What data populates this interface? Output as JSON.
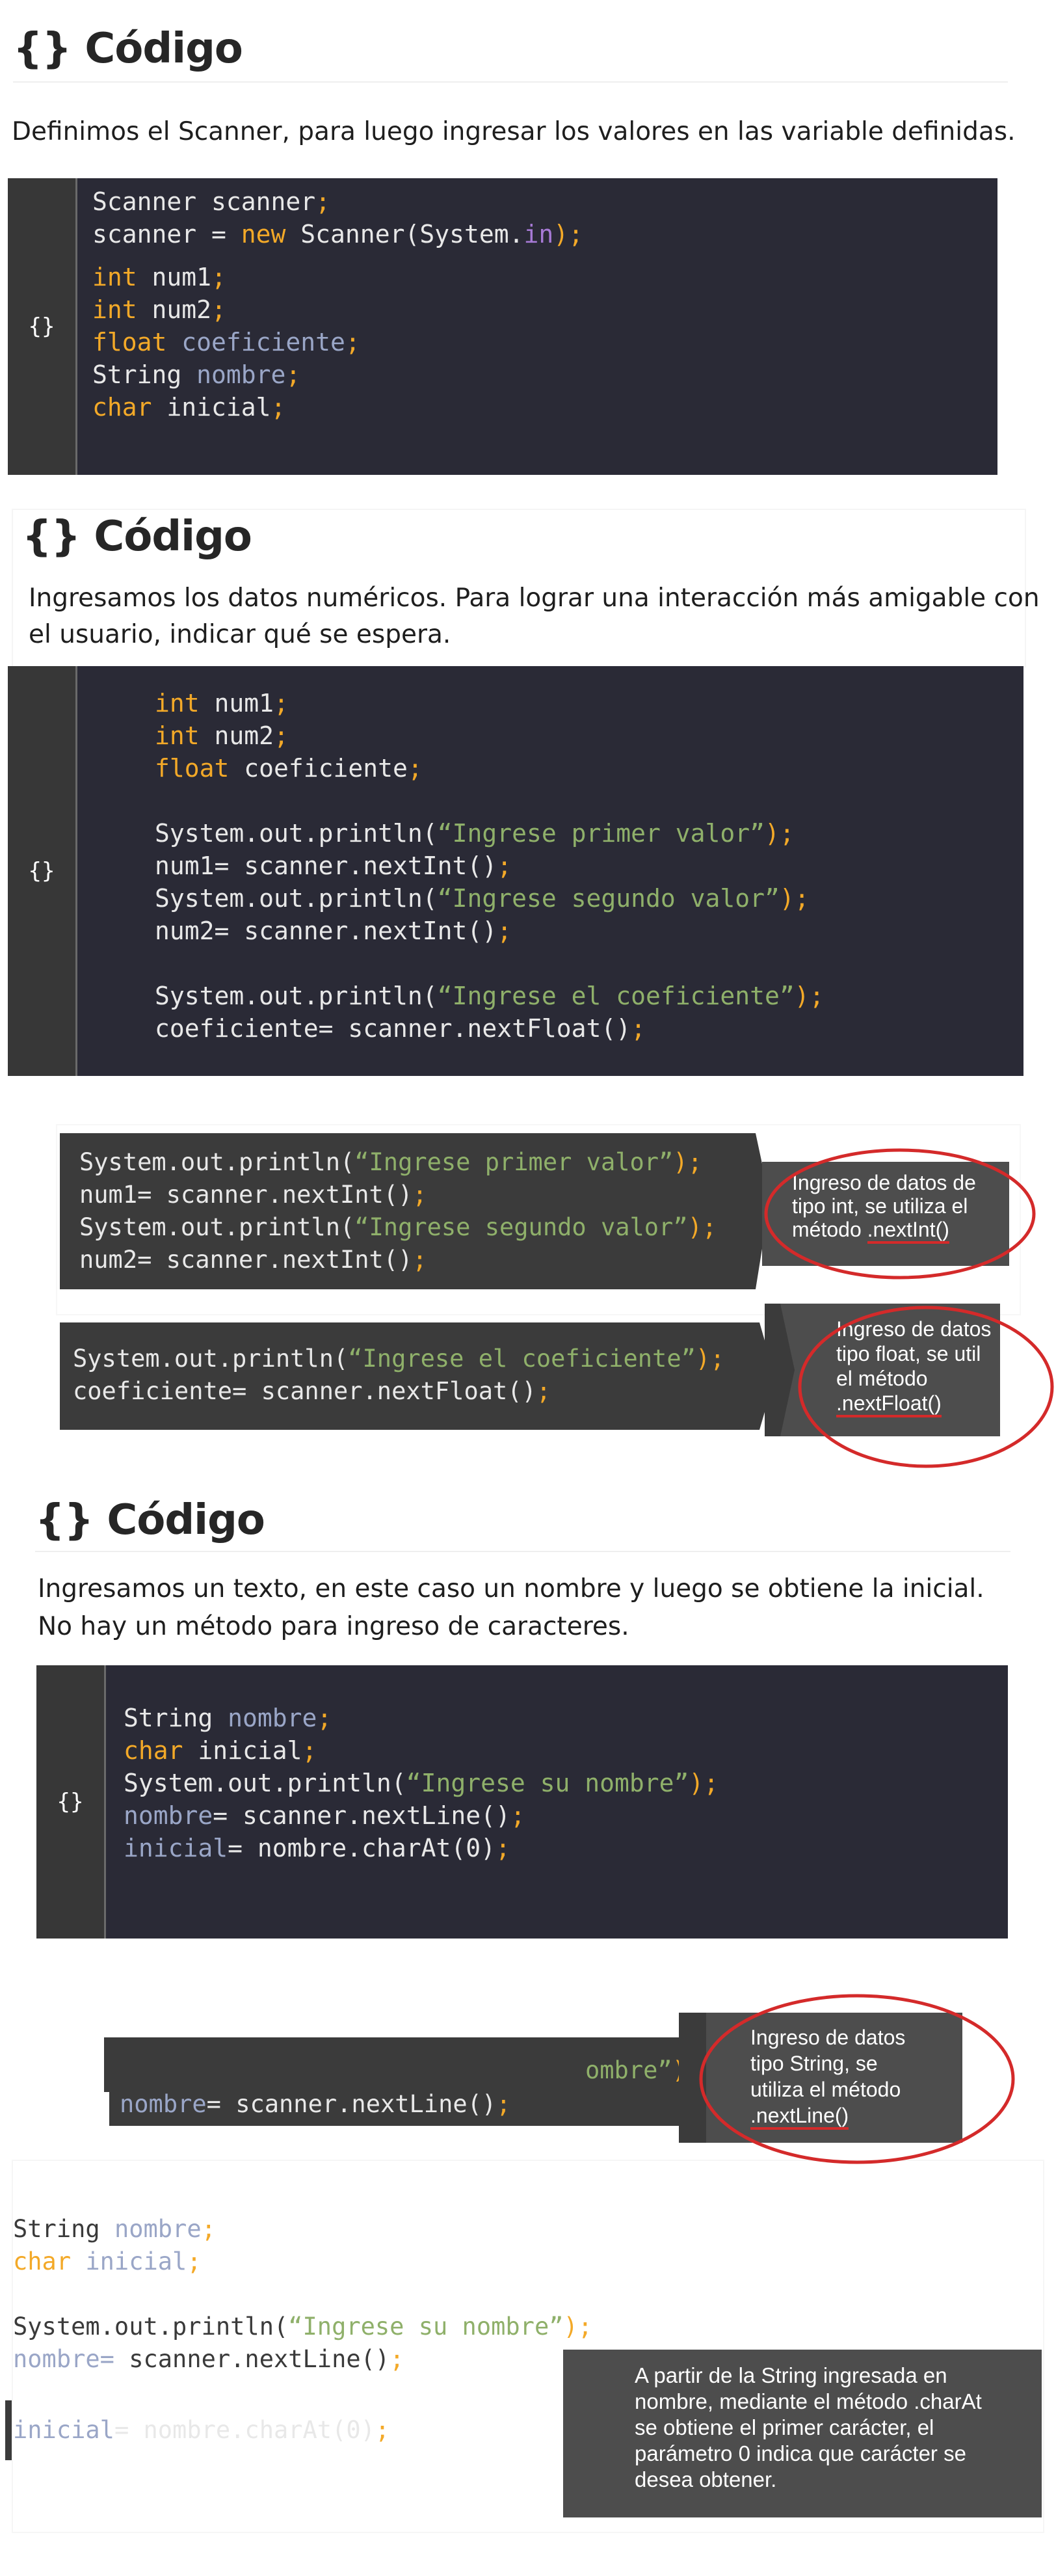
{
  "sections": [
    {
      "title": "{} Código",
      "description": [
        "Definimos el Scanner, para luego ingresar los valores en las variable definidas."
      ],
      "gutter_symbol": "{}",
      "code": {
        "l1": [
          {
            "t": "Scanner scanner",
            "c": ""
          },
          {
            "t": ";",
            "c": "sc"
          }
        ],
        "l2": [
          {
            "t": "scanner = ",
            "c": ""
          },
          {
            "t": "new",
            "c": "kw"
          },
          {
            "t": " Scanner(System.",
            "c": ""
          },
          {
            "t": "in",
            "c": "pu"
          },
          {
            "t": ");",
            "c": "sc"
          }
        ],
        "l3": [
          {
            "t": "int",
            "c": "kw"
          },
          {
            "t": " num1",
            "c": ""
          },
          {
            "t": ";",
            "c": "sc"
          }
        ],
        "l4": [
          {
            "t": "int",
            "c": "kw"
          },
          {
            "t": " num2",
            "c": ""
          },
          {
            "t": ";",
            "c": "sc"
          }
        ],
        "l5": [
          {
            "t": "float",
            "c": "kw"
          },
          {
            "t": " coeficiente",
            "c": "v"
          },
          {
            "t": ";",
            "c": "sc"
          }
        ],
        "l6": [
          {
            "t": "String ",
            "c": ""
          },
          {
            "t": "nombre",
            "c": "v"
          },
          {
            "t": ";",
            "c": "sc"
          }
        ],
        "l7": [
          {
            "t": "char",
            "c": "kw"
          },
          {
            "t": " inicial",
            "c": ""
          },
          {
            "t": ";",
            "c": "sc"
          }
        ]
      }
    },
    {
      "title": "{} Código",
      "description": [
        "Ingresamos los datos numéricos. Para lograr una interacción más amigable con",
        "el usuario, indicar qué se espera."
      ],
      "gutter_symbol": "{}",
      "code": {
        "l1": [
          {
            "t": "int",
            "c": "kw"
          },
          {
            "t": " num1",
            "c": ""
          },
          {
            "t": ";",
            "c": "sc"
          }
        ],
        "l2": [
          {
            "t": "int",
            "c": "kw"
          },
          {
            "t": " num2",
            "c": ""
          },
          {
            "t": ";",
            "c": "sc"
          }
        ],
        "l3": [
          {
            "t": "float",
            "c": "kw"
          },
          {
            "t": " coeficiente",
            "c": ""
          },
          {
            "t": ";",
            "c": "sc"
          }
        ],
        "l4": [],
        "l5": [
          {
            "t": "System.out.println(",
            "c": ""
          },
          {
            "t": "“Ingrese primer valor”",
            "c": "str"
          },
          {
            "t": ");",
            "c": "sc"
          }
        ],
        "l6": [
          {
            "t": "num1= scanner.nextInt()",
            "c": ""
          },
          {
            "t": ";",
            "c": "sc"
          }
        ],
        "l7": [
          {
            "t": "System.out.println(",
            "c": ""
          },
          {
            "t": "“Ingrese segundo valor”",
            "c": "str"
          },
          {
            "t": ");",
            "c": "sc"
          }
        ],
        "l8": [
          {
            "t": "num2= scanner.nextInt()",
            "c": ""
          },
          {
            "t": ";",
            "c": "sc"
          }
        ],
        "l9": [],
        "l10": [
          {
            "t": "System.out.println(",
            "c": ""
          },
          {
            "t": "“Ingrese el coeficiente”",
            "c": "str"
          },
          {
            "t": ");",
            "c": "sc"
          }
        ],
        "l11": [
          {
            "t": "coeficiente= scanner.nextFloat()",
            "c": ""
          },
          {
            "t": ";",
            "c": "sc"
          }
        ]
      }
    },
    {
      "title": "{} Código",
      "description": [
        "Ingresamos un texto, en este caso un nombre y luego se obtiene la inicial.",
        "No hay un método para ingreso de caracteres."
      ],
      "gutter_symbol": "{}",
      "code": {
        "l1": [
          {
            "t": "String ",
            "c": ""
          },
          {
            "t": "nombre",
            "c": "v"
          },
          {
            "t": ";",
            "c": "sc"
          }
        ],
        "l2": [
          {
            "t": "char",
            "c": "kw"
          },
          {
            "t": " inicial",
            "c": ""
          },
          {
            "t": ";",
            "c": "sc"
          }
        ],
        "l3": [
          {
            "t": "System.out.println(",
            "c": ""
          },
          {
            "t": "“Ingrese su nombre”",
            "c": "str"
          },
          {
            "t": ");",
            "c": "sc"
          }
        ],
        "l4": [
          {
            "t": "nombre",
            "c": "v"
          },
          {
            "t": "= scanner.nextLine()",
            "c": ""
          },
          {
            "t": ";",
            "c": "sc"
          }
        ],
        "l5": [
          {
            "t": "inicial",
            "c": "v"
          },
          {
            "t": "= nombre.charAt(0)",
            "c": ""
          },
          {
            "t": ";",
            "c": "sc"
          }
        ]
      }
    }
  ],
  "int_callout": {
    "code": {
      "l1": [
        {
          "t": "System.out.println(",
          "c": ""
        },
        {
          "t": "“Ingrese primer valor”",
          "c": "str"
        },
        {
          "t": ");",
          "c": "sc"
        }
      ],
      "l2": [
        {
          "t": "num1= scanner.nextInt()",
          "c": ""
        },
        {
          "t": ";",
          "c": "sc"
        }
      ],
      "l3": [
        {
          "t": "System.out.println(",
          "c": ""
        },
        {
          "t": "“Ingrese segundo valor”",
          "c": "str"
        },
        {
          "t": ");",
          "c": "sc"
        }
      ],
      "l4": [
        {
          "t": "num2= scanner.nextInt()",
          "c": ""
        },
        {
          "t": ";",
          "c": "sc"
        }
      ]
    },
    "note": [
      "Ingreso de datos de",
      "tipo int, se utiliza el",
      "método ",
      ".nextInt()"
    ]
  },
  "float_callout": {
    "code": {
      "l1": [
        {
          "t": "System.out.println(",
          "c": ""
        },
        {
          "t": "“Ingrese el coeficiente”",
          "c": "str"
        },
        {
          "t": ");",
          "c": "sc"
        }
      ],
      "l2": [
        {
          "t": "coeficiente= scanner.nextFloat()",
          "c": ""
        },
        {
          "t": ";",
          "c": "sc"
        }
      ]
    },
    "note": [
      "Ingreso de datos",
      "tipo float, se util",
      "el método",
      ".nextFloat()"
    ]
  },
  "string_callout": {
    "code": {
      "l1": [
        {
          "t": "ombre”",
          "c": "str"
        },
        {
          "t": ");",
          "c": "sc"
        }
      ],
      "l2": [
        {
          "t": "nombre",
          "c": "v"
        },
        {
          "t": "= scanner.nextLine()",
          "c": ""
        },
        {
          "t": ";",
          "c": "sc"
        }
      ]
    },
    "note": [
      "Ingreso de datos",
      "tipo String, se",
      "utiliza el método",
      ".nextLine()"
    ]
  },
  "charat_panel": {
    "code": {
      "l1": [
        {
          "t": "String ",
          "c": ""
        },
        {
          "t": "nombre",
          "c": "v"
        },
        {
          "t": ";",
          "c": "sc"
        }
      ],
      "l2": [
        {
          "t": "char",
          "c": "kw"
        },
        {
          "t": " inicial",
          "c": "v"
        },
        {
          "t": ";",
          "c": "sc"
        }
      ],
      "l3": [],
      "l4": [
        {
          "t": "System.out.println(",
          "c": ""
        },
        {
          "t": "“Ingrese su nombre”",
          "c": "str"
        },
        {
          "t": ");",
          "c": "sc"
        }
      ],
      "l5": [
        {
          "t": "nombre",
          "c": "v"
        },
        {
          "t": "=",
          "c": "v"
        },
        {
          "t": " scanner.nextLine()",
          "c": ""
        },
        {
          "t": ";",
          "c": "sc"
        }
      ],
      "l6": [
        {
          "t": "inicial",
          "c": "v"
        },
        {
          "t": "= nombre.charAt(0)",
          "c": ""
        },
        {
          "t": ";",
          "c": "sc"
        }
      ]
    },
    "note": [
      "A partir de la String ingresada en",
      "nombre, mediante el método .charAt",
      "se obtiene el primer carácter, el",
      "parámetro 0 indica que carácter se",
      "desea obtener."
    ]
  },
  "colors": {
    "code_bg": "#2a2a36",
    "keyword": "#f3a928",
    "string": "#8fb06a",
    "variable": "#9aa6c7",
    "highlight_ring": "#d42a2a"
  }
}
